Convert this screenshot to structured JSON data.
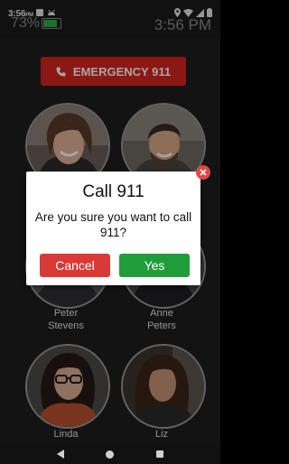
{
  "status_bar": {
    "time": "3:56",
    "ampm": "PM",
    "battery_percent_text": "73%",
    "battery_level": 0.73,
    "clock_large": "3:56 PM"
  },
  "emergency_button": {
    "label": "EMERGENCY 911"
  },
  "contacts": [
    {
      "name_line1": "",
      "name_line2": ""
    },
    {
      "name_line1": "",
      "name_line2": ""
    },
    {
      "name_line1": "Peter",
      "name_line2": "Stevens"
    },
    {
      "name_line1": "Anne",
      "name_line2": "Peters"
    },
    {
      "name_line1": "Linda",
      "name_line2": ""
    },
    {
      "name_line1": "Liz",
      "name_line2": ""
    }
  ],
  "dialog": {
    "title": "Call 911",
    "message": "Are you sure you want to call 911?",
    "cancel_label": "Cancel",
    "confirm_label": "Yes"
  },
  "colors": {
    "emergency_red": "#d6261f",
    "cancel_red": "#d93a35",
    "confirm_green": "#1f9d3a",
    "close_red": "#e14646"
  }
}
